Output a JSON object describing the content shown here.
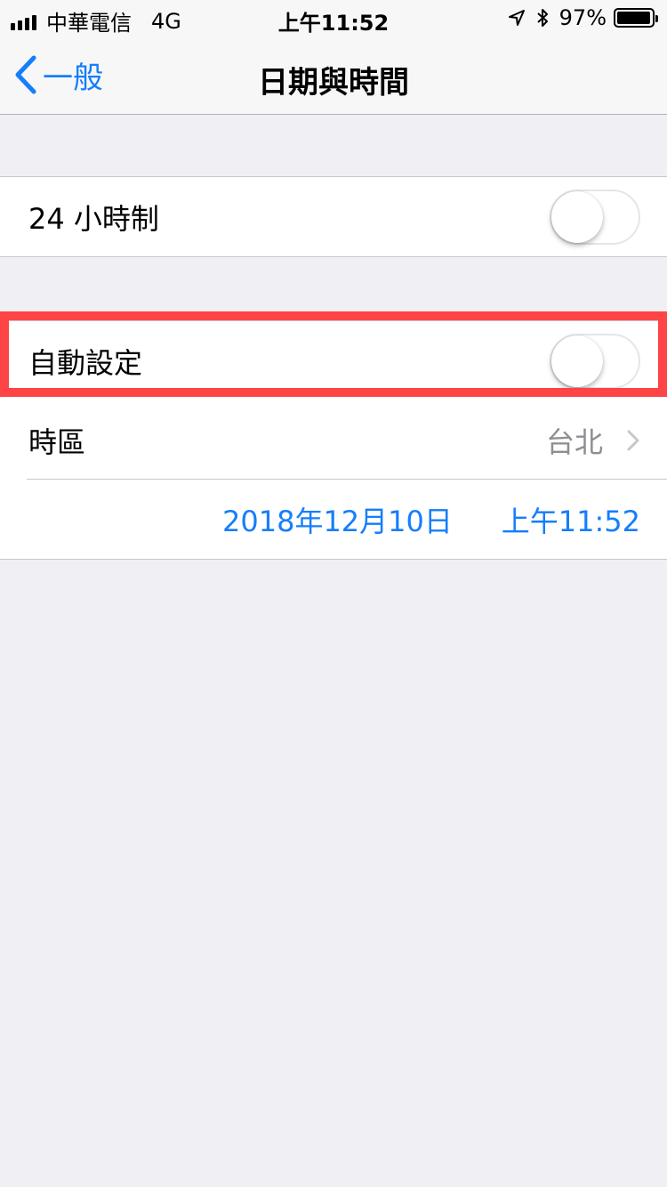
{
  "status_bar": {
    "carrier": "中華電信",
    "network": "4G",
    "time": "上午11:52",
    "battery_percent_label": "97%",
    "battery_level": 0.97,
    "icons": [
      "signal-bars-icon",
      "location-arrow-icon",
      "bluetooth-icon",
      "battery-icon"
    ]
  },
  "nav": {
    "back_label": "一般",
    "title": "日期與時間"
  },
  "settings": {
    "clock_24h": {
      "label": "24 小時制",
      "on": false
    },
    "auto_set": {
      "label": "自動設定",
      "on": false
    },
    "timezone": {
      "label": "時區",
      "value": "台北"
    },
    "date": "2018年12月10日",
    "time": "上午11:52"
  },
  "colors": {
    "accent": "#157efb",
    "highlight": "#fe4444",
    "background": "#efeff4",
    "secondary_text": "#8e8e93"
  }
}
